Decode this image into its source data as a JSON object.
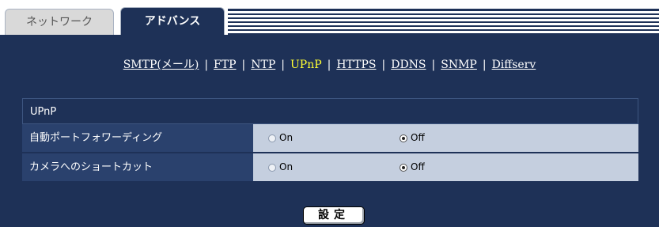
{
  "tabs": [
    {
      "label": "ネットワーク",
      "active": false
    },
    {
      "label": "アドバンス",
      "active": true
    }
  ],
  "nav_links": [
    {
      "label": "SMTP(メール)",
      "active": false
    },
    {
      "label": "FTP",
      "active": false
    },
    {
      "label": "NTP",
      "active": false
    },
    {
      "label": "UPnP",
      "active": true
    },
    {
      "label": "HTTPS",
      "active": false
    },
    {
      "label": "DDNS",
      "active": false
    },
    {
      "label": "SNMP",
      "active": false
    },
    {
      "label": "Diffserv",
      "active": false
    }
  ],
  "nav_separator": "|",
  "section": {
    "title": "UPnP",
    "rows": [
      {
        "label": "自動ポートフォワーディング",
        "on_label": "On",
        "off_label": "Off",
        "selected": "Off"
      },
      {
        "label": "カメラへのショートカット",
        "on_label": "On",
        "off_label": "Off",
        "selected": "Off"
      }
    ]
  },
  "set_button_label": "設定",
  "colors": {
    "background": "#1e3157",
    "active_link": "#ffff33",
    "value_cell": "#c5cfdf"
  }
}
